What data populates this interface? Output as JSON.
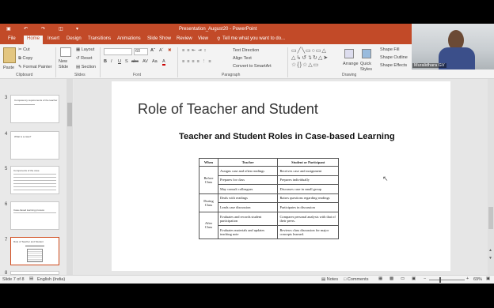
{
  "app": {
    "title": "Presentation_August20 - PowerPoint"
  },
  "tabs": [
    "File",
    "Home",
    "Insert",
    "Design",
    "Transitions",
    "Animations",
    "Slide Show",
    "Review",
    "View"
  ],
  "tell_me": "Tell me what you want to do...",
  "ribbon": {
    "clipboard": {
      "cut": "Cut",
      "copy": "Copy",
      "format_painter": "Format Painter",
      "label": "Clipboard",
      "paste": "Paste"
    },
    "slides": {
      "new_slide": "New Slide",
      "layout": "Layout",
      "reset": "Reset",
      "section": "Section",
      "label": "Slides"
    },
    "font": {
      "size": "60",
      "label": "Font",
      "bold": "B",
      "italic": "I",
      "underline": "U",
      "strike": "S",
      "abc": "abc",
      "spacing": "AV",
      "case": "Aa",
      "color": "A"
    },
    "paragraph": {
      "text_direction": "Text Direction",
      "align_text": "Align Text",
      "smartart": "Convert to SmartArt",
      "label": "Paragraph"
    },
    "drawing": {
      "arrange": "Arrange",
      "quick_styles": "Quick Styles",
      "shape_fill": "Shape Fill",
      "shape_outline": "Shape Outline",
      "shape_effects": "Shape Effects",
      "label": "Drawing"
    }
  },
  "webcam": {
    "name": "Muralidhara GV"
  },
  "thumbnails": [
    {
      "num": "3",
      "text": "Competency requirements of the teacher"
    },
    {
      "num": "4",
      "text": "What is a case?"
    },
    {
      "num": "5",
      "text": "Components of the case"
    },
    {
      "num": "6",
      "text": "Case-based learning process"
    },
    {
      "num": "7",
      "text": "Role of Teacher and Student"
    },
    {
      "num": "8",
      "text": ""
    }
  ],
  "slide": {
    "title": "Role of Teacher and Student",
    "subtitle": "Teacher and Student Roles in Case-based Learning",
    "headers": [
      "When",
      "Teacher",
      "Student or Participant"
    ],
    "groups": [
      {
        "when": "Before Class",
        "rows": [
          [
            "Assigns case and often readings",
            "Receives case and assignment"
          ],
          [
            "Prepares for class",
            "Prepares individually"
          ],
          [
            "May consult colleagues",
            "Discusses case in small group"
          ]
        ]
      },
      {
        "when": "During Class",
        "rows": [
          [
            "Deals with readings",
            "Raises questions regarding readings"
          ],
          [
            "Leads case discussion",
            "Participates in discussion"
          ]
        ]
      },
      {
        "when": "After Class",
        "rows": [
          [
            "Evaluates and records student participation",
            "Compares personal analysis with that of their peers."
          ],
          [
            "Evaluates materials and updates teaching note",
            "Reviews class discussion for major concepts learned."
          ]
        ]
      }
    ]
  },
  "status": {
    "slide": "Slide 7 of 8",
    "language": "English (India)",
    "notes": "Notes",
    "comments": "Comments",
    "zoom": "69%"
  }
}
